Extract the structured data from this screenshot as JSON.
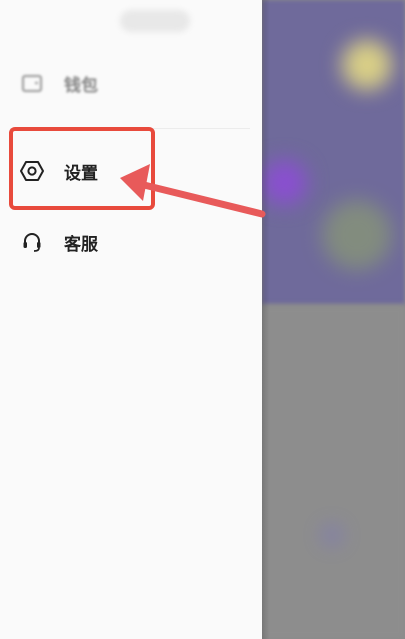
{
  "drawer": {
    "items": [
      {
        "label": "钱包",
        "icon": "wallet-icon"
      },
      {
        "label": "设置",
        "icon": "settings-icon"
      },
      {
        "label": "客服",
        "icon": "headset-icon"
      }
    ]
  },
  "annotation": {
    "color": "#e84a3c",
    "target": "设置"
  },
  "colors": {
    "drawer_bg": "#fafafa",
    "text": "#222222",
    "background_header": "#6f6a9b"
  }
}
